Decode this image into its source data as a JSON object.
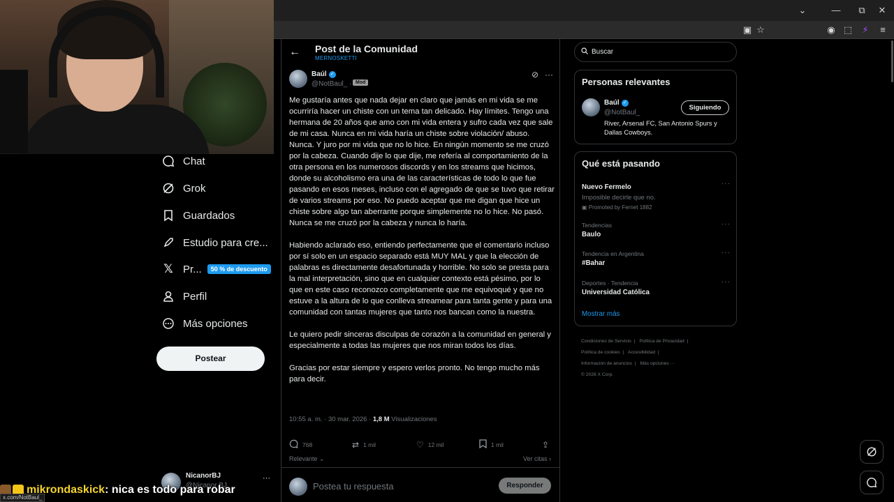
{
  "browser": {
    "window_controls": [
      "⌄",
      "—",
      "⧉",
      "✕"
    ],
    "toolbar_icons": [
      "install-icon",
      "star-icon",
      "extension-1-icon",
      "extensions-icon",
      "extension-2-icon",
      "menu-icon"
    ]
  },
  "nav": {
    "items": [
      {
        "label": "Chat",
        "icon": "chat-icon"
      },
      {
        "label": "Grok",
        "icon": "grok-icon"
      },
      {
        "label": "Guardados",
        "icon": "bookmark-icon"
      },
      {
        "label": "Estudio para cre...",
        "icon": "rocket-icon"
      },
      {
        "label": "Pr...",
        "icon": "x-logo-icon",
        "badge": "50 % de descuento"
      },
      {
        "label": "Perfil",
        "icon": "profile-icon"
      },
      {
        "label": "Más opciones",
        "icon": "more-options-icon"
      }
    ],
    "post_button": "Postear",
    "user": {
      "name": "NicanorBJ",
      "handle": "@Nicanor BJ"
    }
  },
  "chat_overlay": {
    "username": "mikrondaskick",
    "message": ": nica es todo para robar"
  },
  "status_url": "x.com/NotBaul_",
  "post_page": {
    "title": "Post de la Comunidad",
    "community": "MERNOSKETTI",
    "author": {
      "name": "Baúl",
      "handle": "@NotBaul_",
      "separator": "·",
      "role": "Mod"
    },
    "paragraphs": [
      "Me gustaría antes que nada dejar en claro que jamás en mi vida se me ocurriría hacer un chiste con un tema tan delicado. Hay límites. Tengo una hermana de 20 años que amo con mi vida entera y sufro cada vez que sale de mi casa. Nunca en mi vida haría un chiste sobre violación/ abuso. Nunca. Y juro por mi vida que no lo hice. En ningún momento se me cruzó por la cabeza. Cuando dije lo que dije, me refería al comportamiento de la otra persona en los numerosos discords y en los streams que hicimos, donde su alcoholismo era una de las características de todo lo que fue pasando en esos meses, incluso con el agregado de que se tuvo que retirar de varios streams por eso. No puedo aceptar que me digan que hice un chiste sobre algo tan aberrante porque simplemente no lo hice. No pasó. Nunca se me cruzó por la cabeza y nunca lo haría.",
      "Habiendo aclarado eso, entiendo perfectamente que el comentario incluso por sí solo en un espacio separado está MUY MAL y que la elección de palabras es directamente desafortunada y horrible. No solo se presta para la mal interpretación, sino que en cualquier contexto está pésimo, por lo que en este caso reconozco completamente que me equivoqué y que no estuve a la altura de lo que conlleva streamear para tanta gente y para una comunidad con tantas mujeres que tanto nos bancan como la nuestra.",
      "Le quiero pedir sinceras disculpas de corazón a la comunidad en general y especialmente a todas las mujeres que nos miran todos los días.",
      "Gracias por estar siempre y espero verlos pronto. No tengo mucho más para decir."
    ],
    "meta": {
      "time": "10:55 a. m. · 30 mar. 2026 ·",
      "views_count": "1,8 M",
      "views_label": "Visualizaciones"
    },
    "actions": {
      "replies": "768",
      "reposts": "1 mil",
      "likes": "12 mil",
      "bookmarks": "1 mil"
    },
    "sort_label": "Relevante",
    "quotes_label": "Ver citas",
    "reply_placeholder": "Postea tu respuesta",
    "reply_button": "Responder"
  },
  "sidebar": {
    "search_value": "Buscar",
    "relevant": {
      "title": "Personas relevantes",
      "name": "Baúl",
      "handle": "@NotBaul_",
      "follow_label": "Siguiendo",
      "bio": "River, Arsenal FC, San Antonio Spurs y Dallas Cowboys."
    },
    "trends": {
      "title": "Qué está pasando",
      "items": [
        {
          "category": "",
          "title": "Nuevo Fermelo",
          "subtitle": "Imposible decirle que no.",
          "promo": "Promoted by Fernet 1882"
        },
        {
          "category": "Tendencias",
          "title": "Baulo"
        },
        {
          "category": "Tendencia en Argentina",
          "title": "#Bahar"
        },
        {
          "category": "Deportes · Tendencia",
          "title": "Universidad Católica"
        }
      ],
      "show_more": "Mostrar más"
    },
    "footer": [
      "Condiciones de Servicio",
      "|",
      "Política de Privacidad",
      "|",
      "Política de cookies",
      "|",
      "Accesibilidad",
      "|",
      "Información de anuncios",
      "|",
      "Más opciones ···",
      "© 2026 X Corp."
    ]
  },
  "colors": {
    "accent": "#1d9bf0",
    "background": "#000000",
    "text": "#e7e9ea",
    "muted": "#71767b"
  }
}
